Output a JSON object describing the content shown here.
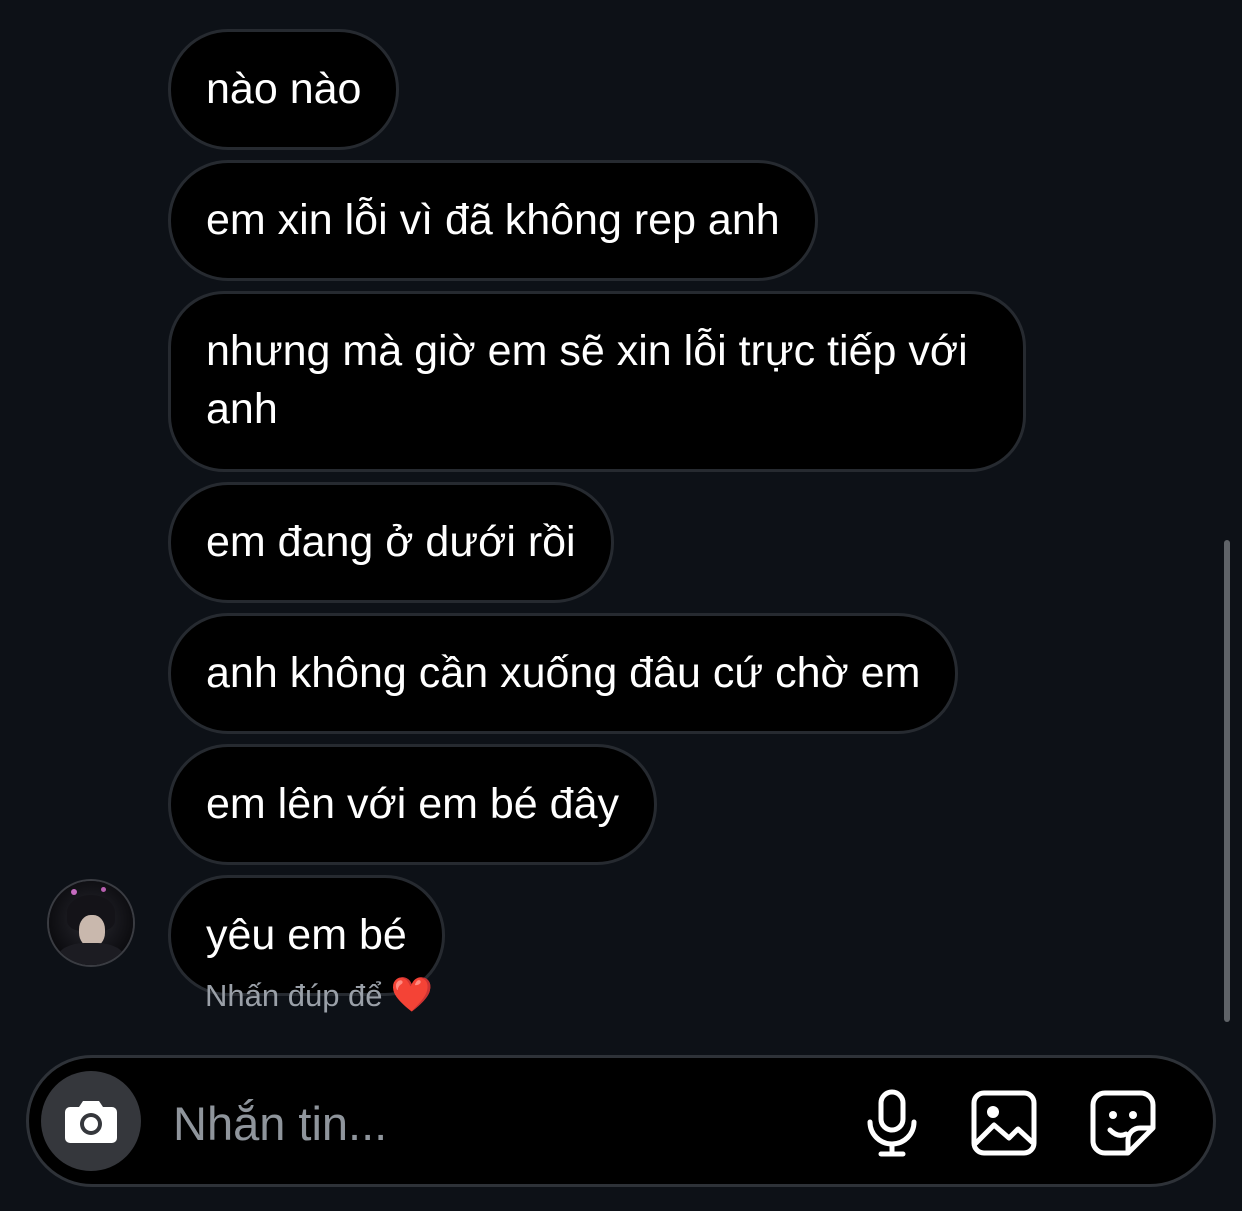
{
  "messages": [
    {
      "text": "nào nào"
    },
    {
      "text": "em xin lỗi vì đã không rep anh"
    },
    {
      "text": "nhưng mà giờ em sẽ xin lỗi trực tiếp với anh"
    },
    {
      "text": "em đang ở dưới rồi"
    },
    {
      "text": "anh không cần xuống đâu cứ chờ em"
    },
    {
      "text": "em lên với em bé đây"
    },
    {
      "text": "yêu em bé"
    }
  ],
  "reaction_hint": {
    "text": "Nhấn đúp để",
    "emoji": "❤️"
  },
  "composer": {
    "placeholder": "Nhắn tin...",
    "icons": {
      "camera": "camera-icon",
      "mic": "microphone-icon",
      "gallery": "gallery-icon",
      "sticker": "sticker-icon"
    }
  },
  "colors": {
    "background": "#0d1117",
    "bubble": "#000000",
    "bubble_border": "#262a30",
    "text": "#ffffff",
    "hint": "#9aa0a8",
    "heart": "#e0192e"
  }
}
